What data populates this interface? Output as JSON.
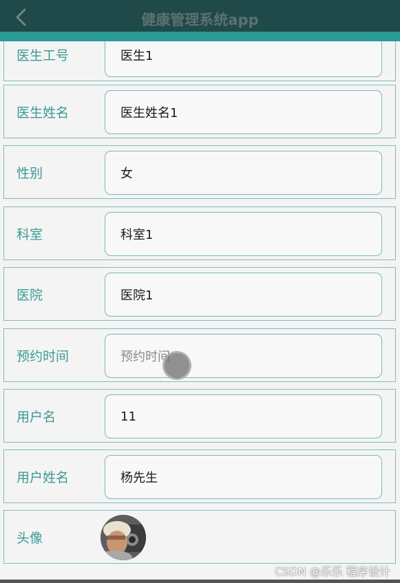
{
  "app": {
    "title": "健康管理系统app"
  },
  "form": {
    "fields": [
      {
        "label": "医生工号",
        "value": "医生1",
        "placeholder": ""
      },
      {
        "label": "医生姓名",
        "value": "医生姓名1",
        "placeholder": ""
      },
      {
        "label": "性别",
        "value": "女",
        "placeholder": ""
      },
      {
        "label": "科室",
        "value": "科室1",
        "placeholder": ""
      },
      {
        "label": "医院",
        "value": "医院1",
        "placeholder": ""
      },
      {
        "label": "预约时间",
        "value": "",
        "placeholder": "预约时间"
      },
      {
        "label": "用户名",
        "value": "11",
        "placeholder": ""
      },
      {
        "label": "用户姓名",
        "value": "杨先生",
        "placeholder": ""
      }
    ],
    "avatar_label": "头像"
  },
  "watermark": "CSDN @乐乐 程序设计",
  "colors": {
    "header": "#1f4a49",
    "accent": "#2a9b95",
    "label": "#3a9a96",
    "border": "#7fbcba"
  },
  "icons": {
    "back": "chevron-left-icon"
  }
}
